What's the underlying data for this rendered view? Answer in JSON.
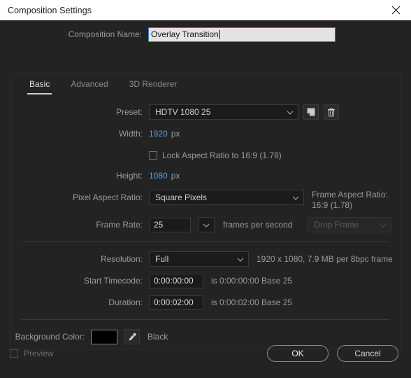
{
  "window": {
    "title": "Composition Settings",
    "close_icon": "close-icon"
  },
  "composition_name": {
    "label": "Composition Name:",
    "value": "Overlay Transition",
    "placeholder": "Composition Name"
  },
  "tabs": [
    {
      "label": "Basic",
      "active": true
    },
    {
      "label": "Advanced",
      "active": false
    },
    {
      "label": "3D Renderer",
      "active": false
    }
  ],
  "basic": {
    "preset": {
      "label": "Preset:",
      "value": "HDTV 1080 25",
      "save_icon": "save-preset-icon",
      "delete_icon": "trash-icon"
    },
    "width": {
      "label": "Width:",
      "value": "1920",
      "unit": "px"
    },
    "height": {
      "label": "Height:",
      "value": "1080",
      "unit": "px"
    },
    "lock_aspect": {
      "label": "Lock Aspect Ratio to 16:9 (1.78)",
      "checked": false
    },
    "pixel_aspect_ratio": {
      "label": "Pixel Aspect Ratio:",
      "value": "Square Pixels"
    },
    "frame_aspect_ratio": {
      "label": "Frame Aspect Ratio:",
      "value": "16:9 (1.78)"
    },
    "frame_rate": {
      "label": "Frame Rate:",
      "value": "25",
      "unit": "frames per second",
      "drop_frame": "Drop Frame"
    },
    "resolution": {
      "label": "Resolution:",
      "value": "Full",
      "info": "1920 x 1080, 7.9 MB per 8bpc frame"
    },
    "start_timecode": {
      "label": "Start Timecode:",
      "value": "0:00:00:00",
      "info": "is 0:00:00:00  Base 25"
    },
    "duration": {
      "label": "Duration:",
      "value": "0:00:02:00",
      "info": "is 0:00:02:00  Base 25"
    },
    "background_color": {
      "label": "Background Color:",
      "swatch_hex": "#000000",
      "eyedropper_icon": "eyedropper-icon",
      "name": "Black"
    }
  },
  "footer": {
    "preview": {
      "label": "Preview",
      "checked": false
    },
    "ok": "OK",
    "cancel": "Cancel"
  },
  "colors": {
    "accent": "#2e7fd4",
    "link": "#5b9fe0",
    "titlebar_bg": "#ffffff",
    "dialog_bg": "#232323"
  }
}
